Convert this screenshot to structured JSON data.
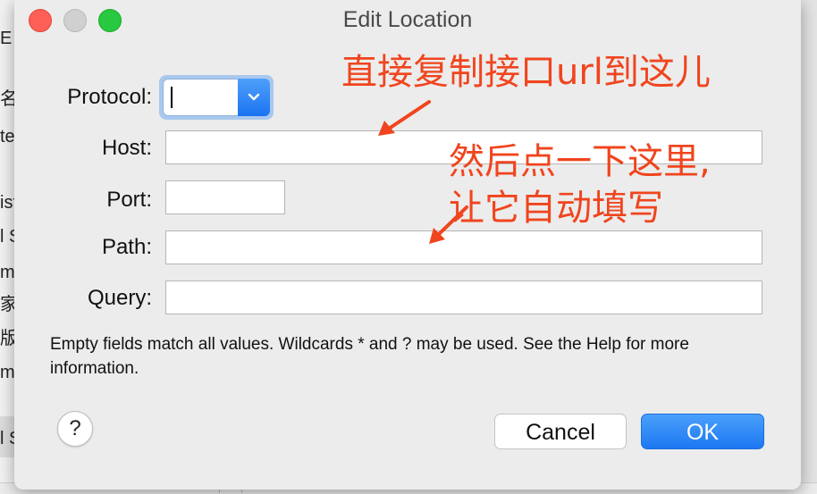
{
  "background": {
    "fragments": [
      "E",
      "名",
      "te",
      "ist",
      "l S",
      "m",
      "家",
      "版",
      "m",
      "l S"
    ]
  },
  "window": {
    "title": "Edit Location"
  },
  "form": {
    "protocol_label": "Protocol:",
    "protocol_value": "",
    "host_label": "Host:",
    "host_value": "",
    "port_label": "Port:",
    "port_value": "",
    "path_label": "Path:",
    "path_value": "",
    "query_label": "Query:",
    "query_value": ""
  },
  "note": "Empty fields match all values. Wildcards * and ? may be used. See the Help for more information.",
  "buttons": {
    "help": "?",
    "cancel": "Cancel",
    "ok": "OK"
  },
  "annotations": {
    "top": "直接复制接口url到这儿",
    "middle_line1": "然后点一下这里,",
    "middle_line2": "让它自动填写",
    "color": "#f0451e"
  },
  "colors": {
    "accent": "#1d78f2",
    "close": "#fe5f57",
    "maximize": "#28c840"
  }
}
